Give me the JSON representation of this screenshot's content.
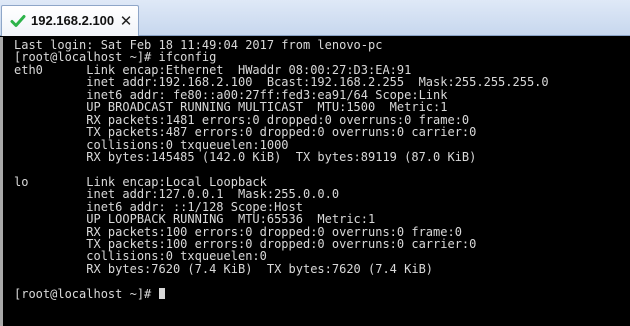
{
  "tab": {
    "title": "192.168.2.100",
    "close_label": "✕",
    "status_icon": "check-icon",
    "status_color": "#2db34a"
  },
  "terminal": {
    "lines": [
      "Last login: Sat Feb 18 11:49:04 2017 from lenovo-pc",
      "[root@localhost ~]# ifconfig",
      "eth0      Link encap:Ethernet  HWaddr 08:00:27:D3:EA:91",
      "          inet addr:192.168.2.100  Bcast:192.168.2.255  Mask:255.255.255.0",
      "          inet6 addr: fe80::a00:27ff:fed3:ea91/64 Scope:Link",
      "          UP BROADCAST RUNNING MULTICAST  MTU:1500  Metric:1",
      "          RX packets:1481 errors:0 dropped:0 overruns:0 frame:0",
      "          TX packets:487 errors:0 dropped:0 overruns:0 carrier:0",
      "          collisions:0 txqueuelen:1000",
      "          RX bytes:145485 (142.0 KiB)  TX bytes:89119 (87.0 KiB)",
      "",
      "lo        Link encap:Local Loopback",
      "          inet addr:127.0.0.1  Mask:255.0.0.0",
      "          inet6 addr: ::1/128 Scope:Host",
      "          UP LOOPBACK RUNNING  MTU:65536  Metric:1",
      "          RX packets:100 errors:0 dropped:0 overruns:0 frame:0",
      "          TX packets:100 errors:0 dropped:0 overruns:0 carrier:0",
      "          collisions:0 txqueuelen:0",
      "          RX bytes:7620 (7.4 KiB)  TX bytes:7620 (7.4 KiB)",
      ""
    ],
    "prompt": "[root@localhost ~]# ",
    "text_color": "#d9d9d9",
    "background_color": "#000000"
  }
}
